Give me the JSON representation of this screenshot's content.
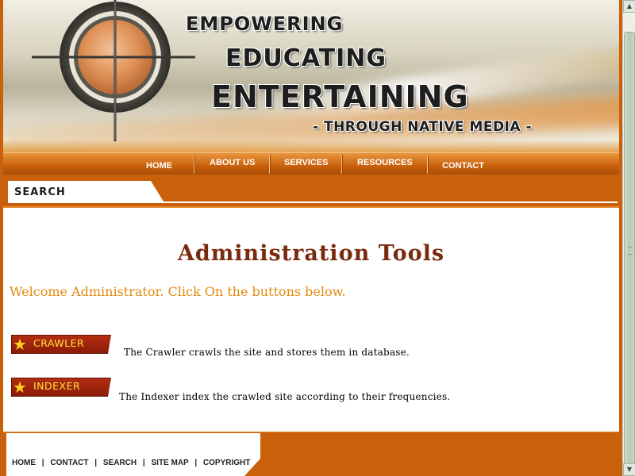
{
  "banner": {
    "line1": "EMPOWERING",
    "line2": "EDUCATING",
    "line3": "ENTERTAINING",
    "tagline": "- THROUGH NATIVE MEDIA -"
  },
  "nav": {
    "items": [
      {
        "label": "HOME"
      },
      {
        "label": "ABOUT US"
      },
      {
        "label": "SERVICES"
      },
      {
        "label": "RESOURCES"
      },
      {
        "label": "CONTACT"
      }
    ]
  },
  "search": {
    "tab_label": "SEARCH"
  },
  "main": {
    "title": "Administration Tools",
    "welcome": "Welcome Administrator. Click On the buttons below.",
    "tools": [
      {
        "button_label": "CRAWLER",
        "description": "The Crawler crawls the site and stores them in database."
      },
      {
        "button_label": "INDEXER",
        "description": "The Indexer index the crawled site according to their frequencies."
      }
    ]
  },
  "footer": {
    "links": [
      "HOME",
      "CONTACT",
      "SEARCH",
      "SITE MAP",
      "COPYRIGHT"
    ],
    "separator": "|"
  },
  "colors": {
    "brand_orange": "#c9600c",
    "title_brown": "#7a2b0e",
    "welcome_orange": "#e28a0e",
    "button_red": "#8c1c07",
    "button_text": "#ffe43a"
  },
  "icons": {
    "target": "crosshair-target-icon",
    "star": "star-icon"
  }
}
